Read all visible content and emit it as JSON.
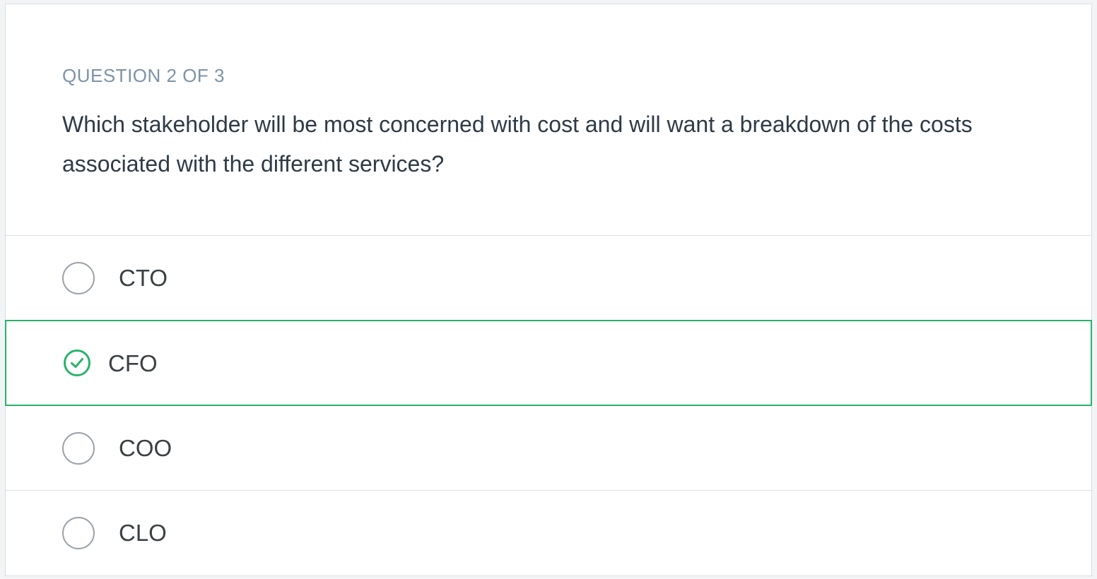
{
  "question": {
    "counter": "QUESTION 2 OF 3",
    "text": "Which stakeholder will be most concerned with cost and will want a breakdown of the costs associated with the different services?"
  },
  "options": [
    {
      "label": "CTO",
      "selected": false
    },
    {
      "label": "CFO",
      "selected": true,
      "icon": "check-circle-icon"
    },
    {
      "label": "COO",
      "selected": false
    },
    {
      "label": "CLO",
      "selected": false
    }
  ],
  "colors": {
    "correct": "#27b36b",
    "counter": "#7d93a6",
    "text": "#2e3a46"
  }
}
